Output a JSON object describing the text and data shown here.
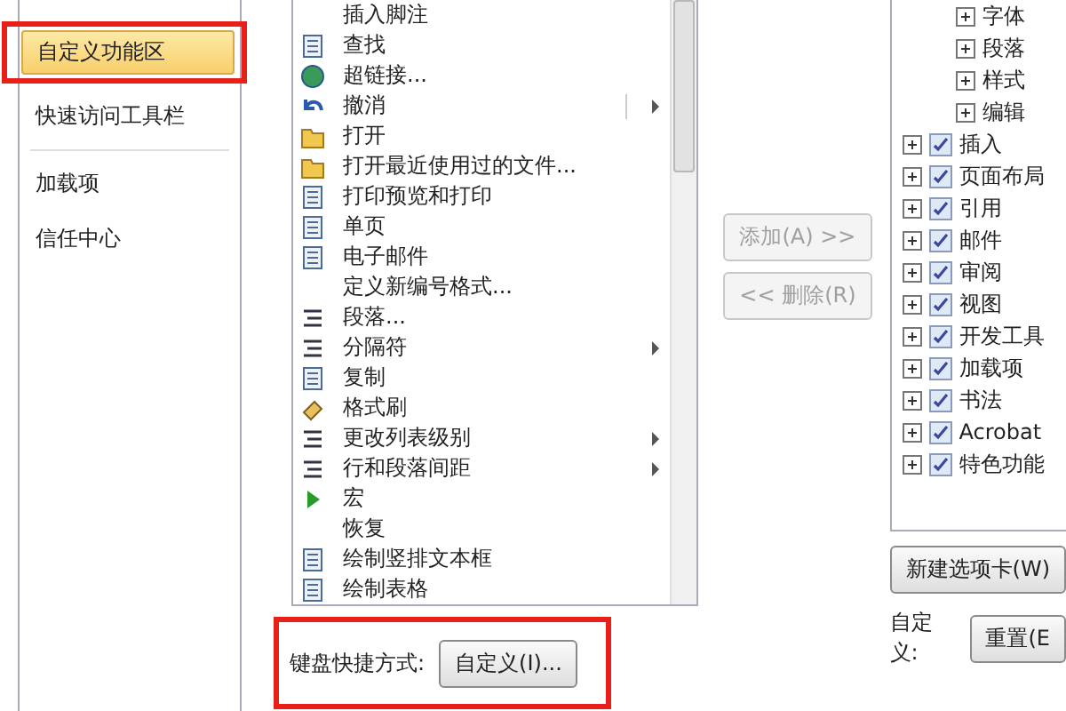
{
  "nav": {
    "items": [
      {
        "label": "自定义功能区",
        "selected": true
      },
      {
        "label": "快速访问工具栏",
        "selected": false
      },
      {
        "label": "加载项",
        "selected": false
      },
      {
        "label": "信任中心",
        "selected": false
      }
    ]
  },
  "commands": {
    "items": [
      {
        "label": "插入脚注",
        "submenu": false
      },
      {
        "label": "查找",
        "submenu": false
      },
      {
        "label": "超链接...",
        "submenu": false
      },
      {
        "label": "撤消",
        "submenu": true
      },
      {
        "label": "打开",
        "submenu": false
      },
      {
        "label": "打开最近使用过的文件...",
        "submenu": false
      },
      {
        "label": "打印预览和打印",
        "submenu": false
      },
      {
        "label": "单页",
        "submenu": false
      },
      {
        "label": "电子邮件",
        "submenu": false
      },
      {
        "label": "定义新编号格式...",
        "submenu": false
      },
      {
        "label": "段落...",
        "submenu": false
      },
      {
        "label": "分隔符",
        "submenu": true
      },
      {
        "label": "复制",
        "submenu": false
      },
      {
        "label": "格式刷",
        "submenu": false
      },
      {
        "label": "更改列表级别",
        "submenu": true
      },
      {
        "label": "行和段落间距",
        "submenu": true
      },
      {
        "label": "宏",
        "submenu": false
      },
      {
        "label": "恢复",
        "submenu": false
      },
      {
        "label": "绘制竖排文本框",
        "submenu": false
      },
      {
        "label": "绘制表格",
        "submenu": false
      }
    ]
  },
  "keyboard_shortcut": {
    "label": "键盘快捷方式:",
    "button": "自定义(I)..."
  },
  "transfer_buttons": [
    {
      "label": "添加(A) >>",
      "disabled": true
    },
    {
      "label": "<< 删除(R)",
      "disabled": true
    }
  ],
  "ribbon_tree": [
    {
      "children": [
        {
          "label": "字体"
        },
        {
          "label": "段落"
        },
        {
          "label": "样式"
        },
        {
          "label": "编辑"
        }
      ]
    },
    {
      "label": "插入",
      "checked": true
    },
    {
      "label": "页面布局",
      "checked": true
    },
    {
      "label": "引用",
      "checked": true
    },
    {
      "label": "邮件",
      "checked": true
    },
    {
      "label": "审阅",
      "checked": true
    },
    {
      "label": "视图",
      "checked": true
    },
    {
      "label": "开发工具",
      "checked": true
    },
    {
      "label": "加载项",
      "checked": true
    },
    {
      "label": "书法",
      "checked": true
    },
    {
      "label": "Acrobat",
      "checked": true
    },
    {
      "label": "特色功能",
      "checked": true
    }
  ],
  "new_tab_button": "新建选项卡(W)",
  "customize": {
    "label": "自定义:",
    "reset_button": "重置(E"
  }
}
